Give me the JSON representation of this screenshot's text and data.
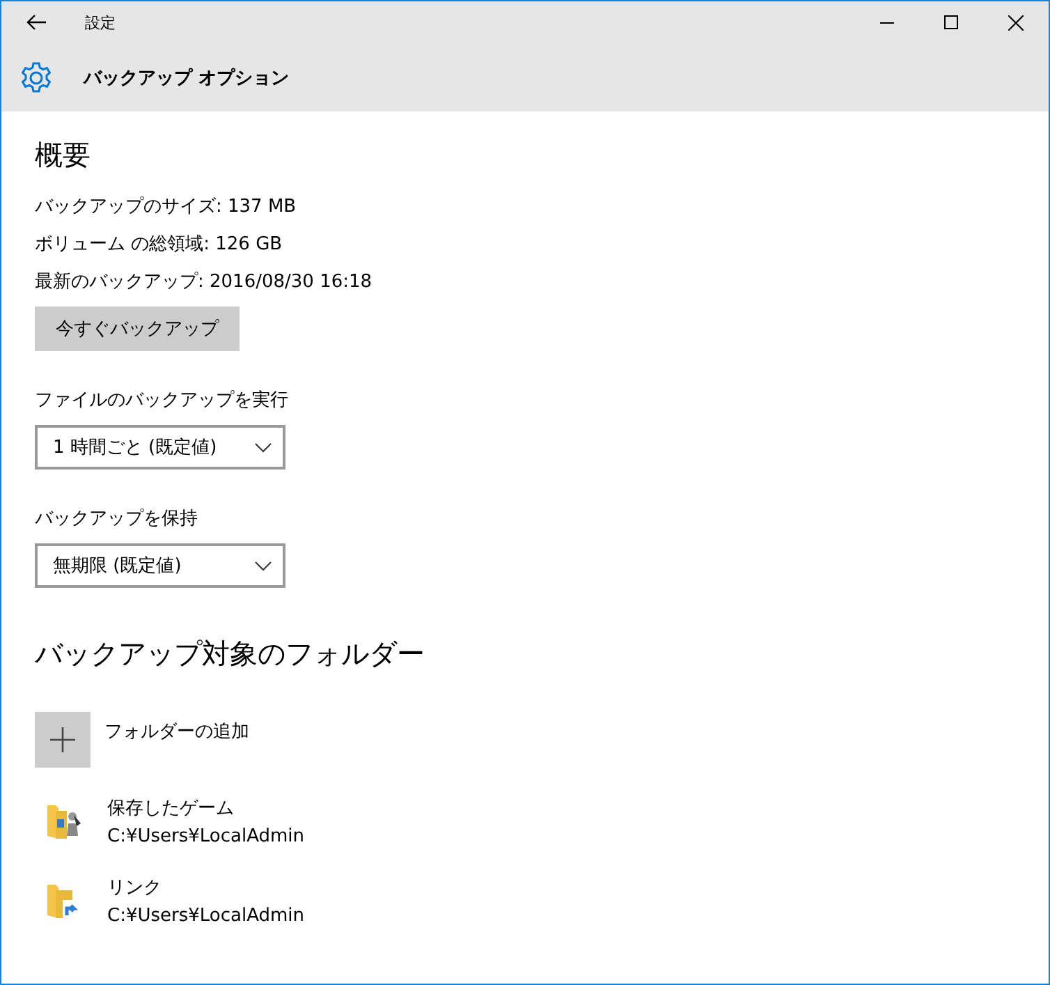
{
  "window": {
    "title": "設定"
  },
  "header": {
    "title": "バックアップ オプション"
  },
  "overview": {
    "heading": "概要",
    "lines": [
      "バックアップのサイズ: 137 MB",
      "ボリューム の総領域: 126 GB",
      "最新のバックアップ: 2016/08/30 16:18"
    ],
    "button": "今すぐバックアップ"
  },
  "settings": [
    {
      "label": "ファイルのバックアップを実行",
      "value": "1 時間ごと (既定値)"
    },
    {
      "label": "バックアップを保持",
      "value": "無期限 (既定値)"
    }
  ],
  "folders": {
    "heading": "バックアップ対象のフォルダー",
    "add_label": "フォルダーの追加",
    "items": [
      {
        "kind": "games",
        "name": "保存したゲーム",
        "path": "C:¥Users¥LocalAdmin"
      },
      {
        "kind": "link",
        "name": "リンク",
        "path": "C:¥Users¥LocalAdmin"
      }
    ]
  }
}
